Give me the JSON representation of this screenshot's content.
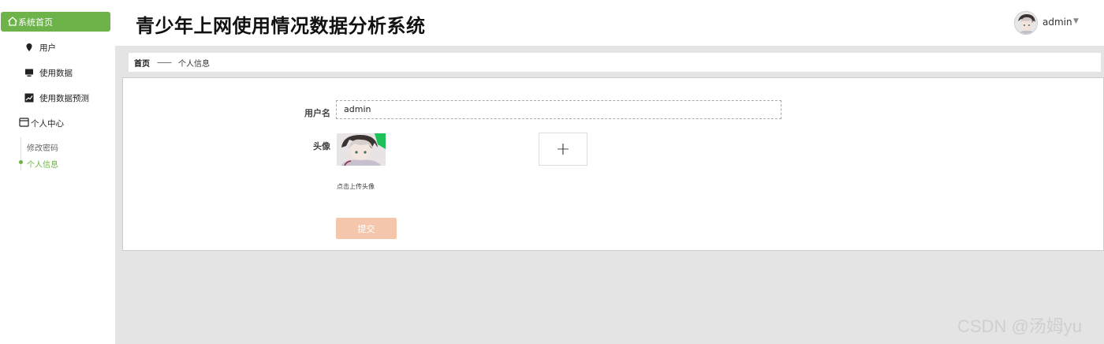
{
  "sidebar": {
    "home_label": "系统首页",
    "items": [
      {
        "label": "用户",
        "icon": "pin-icon"
      },
      {
        "label": "使用数据",
        "icon": "monitor-icon"
      },
      {
        "label": "使用数据预测",
        "icon": "chart-icon"
      }
    ],
    "group": {
      "label": "个人中心",
      "icon": "window-icon",
      "children": [
        {
          "label": "修改密码"
        },
        {
          "label": "个人信息"
        }
      ]
    }
  },
  "header": {
    "title": "青少年上网使用情况数据分析系统",
    "username": "admin",
    "caret": "▼"
  },
  "breadcrumb": {
    "home": "首页",
    "separator": "——",
    "current": "个人信息"
  },
  "form": {
    "username_label": "用户名",
    "username_value": "admin",
    "avatar_label": "头像",
    "upload_symbol": "+",
    "upload_hint": "点击上传头像",
    "submit_label": "提交"
  },
  "watermark": "CSDN @汤姆yu",
  "colors": {
    "accent": "#6db34a",
    "submit": "#f4c7ad",
    "background": "#e4e4e4"
  }
}
